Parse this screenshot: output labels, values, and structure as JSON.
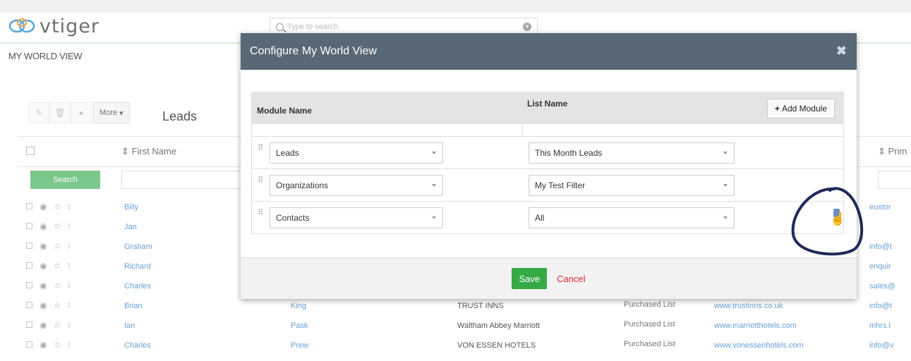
{
  "app": {
    "brand": "vtiger",
    "search_placeholder": "Type to search",
    "page_title": "MY WORLD VIEW"
  },
  "list": {
    "more_label": "More",
    "module_title": "Leads",
    "col_first_name": "First Name",
    "col_primary": "Prim",
    "search_label": "Search",
    "rows": [
      {
        "first": "Billy",
        "last": "",
        "company": "",
        "source": "",
        "website": "",
        "email": "eustor"
      },
      {
        "first": "Jan",
        "last": "",
        "company": "",
        "source": "",
        "website": "",
        "email": ""
      },
      {
        "first": "Graham",
        "last": "",
        "company": "",
        "source": "",
        "website": "",
        "email": "info@t"
      },
      {
        "first": "Richard",
        "last": "",
        "company": "",
        "source": "",
        "website": "",
        "email": "enquir"
      },
      {
        "first": "Charles",
        "last": "",
        "company": "",
        "source": "",
        "website": "",
        "email": "sales@"
      },
      {
        "first": "Brian",
        "last": "King",
        "company": "TRUST INNS",
        "source": "Purchased List",
        "website": "www.trustinns.co.uk",
        "email": "info@t"
      },
      {
        "first": "Ian",
        "last": "Pask",
        "company": "Waltham Abbey Marriott",
        "source": "Purchased List",
        "website": "www.marriotthotels.com",
        "email": "mhrs.l"
      },
      {
        "first": "Charles",
        "last": "Prew",
        "company": "VON ESSEN HOTELS",
        "source": "Purchased List",
        "website": "www.vonessenhotels.com",
        "email": "info@v"
      }
    ]
  },
  "modal": {
    "title": "Configure My World View",
    "col_module": "Module Name",
    "col_list": "List Name",
    "add_module": "Add Module",
    "rows": [
      {
        "module": "Leads",
        "list": "This Month Leads"
      },
      {
        "module": "Organizations",
        "list": "My Test Filter"
      },
      {
        "module": "Contacts",
        "list": "All"
      }
    ],
    "save_label": "Save",
    "cancel_label": "Cancel"
  },
  "colors": {
    "modal_header": "#596875",
    "save_button": "#35aa47",
    "cancel_text": "#e0262b",
    "link": "#6a9fd4",
    "annotation": "#1e2a5a"
  }
}
